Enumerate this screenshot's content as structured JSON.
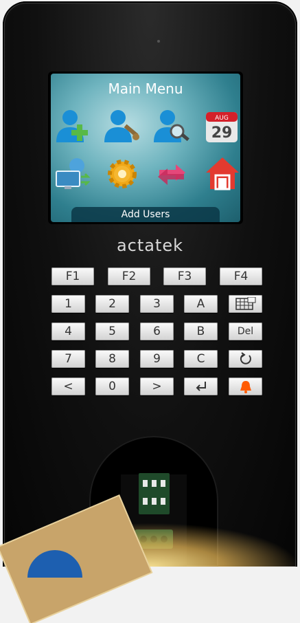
{
  "screen": {
    "title": "Main Menu",
    "selected_label": "Add Users",
    "calendar": {
      "month": "AUG",
      "day": "29"
    },
    "icons": [
      "add-user-icon",
      "edit-user-icon",
      "search-user-icon",
      "calendar-icon",
      "network-icon",
      "settings-gear-icon",
      "sync-arrows-icon",
      "home-icon"
    ]
  },
  "brand": "actatek",
  "keypad": {
    "function_keys": [
      "F1",
      "F2",
      "F3",
      "F4"
    ],
    "rows": [
      [
        "1",
        "2",
        "3",
        "A"
      ],
      [
        "4",
        "5",
        "6",
        "B"
      ],
      [
        "7",
        "8",
        "9",
        "C"
      ],
      [
        "<",
        "0",
        ">"
      ]
    ],
    "side_keys": {
      "del": "Del"
    }
  },
  "colors": {
    "screen_teal": "#2f7f8e",
    "user_blue": "#1a8fd6",
    "alarm_orange": "#ff5a00"
  }
}
